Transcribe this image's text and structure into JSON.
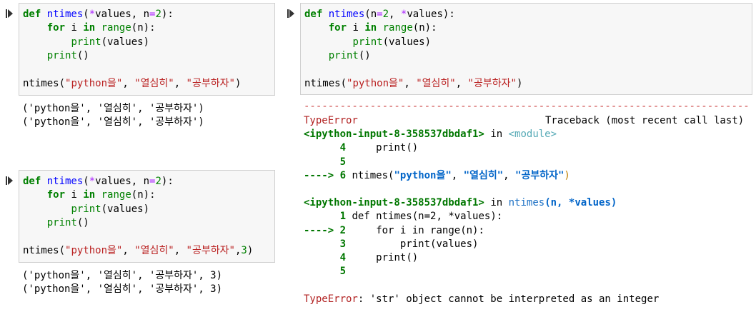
{
  "cells": {
    "c1": {
      "lines": [
        [
          "def ",
          "ntimes",
          "(",
          "*",
          "values, n",
          "=",
          "2",
          "):"
        ],
        [
          "for",
          "i",
          "in",
          "range",
          "(n):"
        ],
        [
          "print",
          "(values)"
        ],
        [
          "print",
          "()"
        ],
        [
          "ntimes(",
          "\"python을\"",
          ", ",
          "\"열심히\"",
          ", ",
          "\"공부하자\"",
          ")"
        ]
      ],
      "output": [
        "('python을', '열심히', '공부하자')",
        "('python을', '열심히', '공부하자')"
      ]
    },
    "c2": {
      "lines": [
        [
          "def ",
          "ntimes",
          "(",
          "*",
          "values, n",
          "=",
          "2",
          "):"
        ],
        [
          "for",
          "i",
          "in",
          "range",
          "(n):"
        ],
        [
          "print",
          "(values)"
        ],
        [
          "print",
          "()"
        ],
        [
          "ntimes(",
          "\"python을\"",
          ", ",
          "\"열심히\"",
          ", ",
          "\"공부하자\"",
          ",",
          "3",
          ")"
        ]
      ],
      "output": [
        "('python을', '열심히', '공부하자', 3)",
        "('python을', '열심히', '공부하자', 3)"
      ]
    },
    "c3": {
      "lines": [
        [
          "def ",
          "ntimes",
          "(n",
          "=",
          "2",
          ", ",
          "*",
          "values):"
        ],
        [
          "for",
          "i",
          "in",
          "range",
          "(n):"
        ],
        [
          "print",
          "(values)"
        ],
        [
          "print",
          "()"
        ],
        [
          "ntimes(",
          "\"python을\"",
          ", ",
          "\"열심히\"",
          ", ",
          "\"공부하자\"",
          ")"
        ]
      ]
    }
  },
  "traceback": {
    "error_name": "TypeError",
    "header_right": "Traceback (most recent call last)",
    "frame1_loc": "<ipython-input-8-358537dbdaf1>",
    "in_word": "in",
    "frame1_fn": "<module>",
    "frame1": [
      {
        "num": "4",
        "code": "print()"
      },
      {
        "num": "5",
        "code": ""
      },
      {
        "num": "6",
        "arrow": "---->",
        "code_pre": "ntimes(",
        "s1": "\"python을\"",
        "s2": "\"열심히\"",
        "s3": "\"공부하자\"",
        "code_post": ")"
      }
    ],
    "frame2_loc": "<ipython-input-8-358537dbdaf1>",
    "frame2_fn": "ntimes",
    "frame2_args": "(n, *values)",
    "frame2": [
      {
        "num": "1",
        "code": "def ntimes(n=2, *values):"
      },
      {
        "num": "2",
        "arrow": "---->",
        "code": "for i in range(n):"
      },
      {
        "num": "3",
        "code": "print(values)"
      },
      {
        "num": "4",
        "code": "print()"
      },
      {
        "num": "5",
        "code": ""
      }
    ],
    "final_name": "TypeError",
    "final_msg": ": 'str' object cannot be interpreted as an integer"
  },
  "colors": {
    "border": "#cfcfcf",
    "cell_bg": "#f7f7f7",
    "error": "#b22222"
  },
  "icons": {
    "run": "run-cell-icon"
  }
}
